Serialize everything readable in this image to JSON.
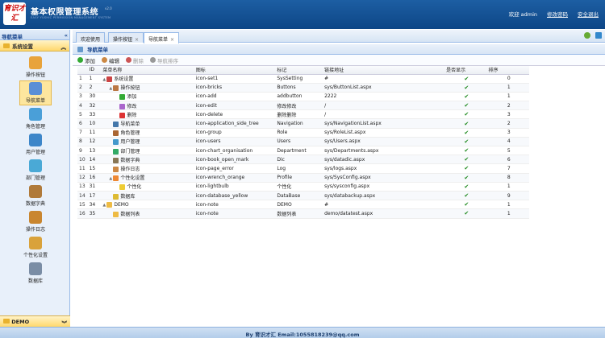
{
  "header": {
    "logo_text": "育识才汇",
    "title": "基本权限管理系统",
    "version": "v2.0",
    "subtitle": "EASY YUSHIC PERMISSION MANAGEMENT SYSTEM",
    "welcome": "欢迎 admin",
    "change_password": "修改密码",
    "logout": "安全退出"
  },
  "sidebar": {
    "head": "导航菜单",
    "group": "系统设置",
    "items": [
      {
        "label": "操作按钮",
        "icon": "buttons-icon"
      },
      {
        "label": "导航菜单",
        "icon": "navigation-icon"
      },
      {
        "label": "角色管理",
        "icon": "role-icon"
      },
      {
        "label": "用户管理",
        "icon": "users-icon"
      },
      {
        "label": "部门管理",
        "icon": "department-icon"
      },
      {
        "label": "数据字典",
        "icon": "dictionary-icon"
      },
      {
        "label": "操作日志",
        "icon": "log-icon"
      },
      {
        "label": "个性化设置",
        "icon": "profile-icon"
      },
      {
        "label": "数据库",
        "icon": "database-icon"
      }
    ],
    "bottom_group": "DEMO"
  },
  "tabs": [
    {
      "label": "欢迎使用",
      "close": ""
    },
    {
      "label": "操作按钮",
      "close": "×"
    },
    {
      "label": "导航菜单",
      "close": "×"
    }
  ],
  "panel_title": "导航菜单",
  "toolbar": {
    "add": "添加",
    "edit": "编辑",
    "delete": "删除",
    "order": "导航排序"
  },
  "columns": [
    "ID",
    "菜单名称",
    "图标",
    "标记",
    "链接地址",
    "是否显示",
    "排序"
  ],
  "rows": [
    {
      "n": "1",
      "id": "1",
      "name": "系统设置",
      "icon": "icon-set1",
      "tag": "SysSetting",
      "url": "#",
      "show": "✔",
      "sort": "0",
      "lvl": 0,
      "tw": "▲",
      "c": "#c44"
    },
    {
      "n": "2",
      "id": "2",
      "name": "操作按钮",
      "icon": "icon-bricks",
      "tag": "Buttons",
      "url": "sys/ButtonList.aspx",
      "show": "✔",
      "sort": "1",
      "lvl": 1,
      "tw": "▲",
      "c": "#b74"
    },
    {
      "n": "3",
      "id": "30",
      "name": "添加",
      "icon": "icon-add",
      "tag": "addbutton",
      "url": "2222",
      "show": "✔",
      "sort": "1",
      "lvl": 2,
      "tw": "",
      "c": "#3a3"
    },
    {
      "n": "4",
      "id": "32",
      "name": "修改",
      "icon": "icon-edit",
      "tag": "修改修改",
      "url": "/",
      "show": "✔",
      "sort": "2",
      "lvl": 2,
      "tw": "",
      "c": "#a6c"
    },
    {
      "n": "5",
      "id": "33",
      "name": "删除",
      "icon": "icon-delete",
      "tag": "删除删除",
      "url": "/",
      "show": "✔",
      "sort": "3",
      "lvl": 2,
      "tw": "",
      "c": "#d33"
    },
    {
      "n": "6",
      "id": "10",
      "name": "导航菜单",
      "icon": "icon-application_side_tree",
      "tag": "Navigation",
      "url": "sys/NavigationList.aspx",
      "show": "✔",
      "sort": "2",
      "lvl": 1,
      "tw": "",
      "c": "#47a"
    },
    {
      "n": "7",
      "id": "11",
      "name": "角色管理",
      "icon": "icon-group",
      "tag": "Role",
      "url": "sys/RoleList.aspx",
      "show": "✔",
      "sort": "3",
      "lvl": 1,
      "tw": "",
      "c": "#a63"
    },
    {
      "n": "8",
      "id": "12",
      "name": "用户管理",
      "icon": "icon-users",
      "tag": "Users",
      "url": "sys/Users.aspx",
      "show": "✔",
      "sort": "4",
      "lvl": 1,
      "tw": "",
      "c": "#49c"
    },
    {
      "n": "9",
      "id": "13",
      "name": "部门管理",
      "icon": "icon-chart_organisation",
      "tag": "Department",
      "url": "sys/Departments.aspx",
      "show": "✔",
      "sort": "5",
      "lvl": 1,
      "tw": "",
      "c": "#3a6"
    },
    {
      "n": "10",
      "id": "14",
      "name": "数据字典",
      "icon": "icon-book_open_mark",
      "tag": "Dic",
      "url": "sys/datadic.aspx",
      "show": "✔",
      "sort": "6",
      "lvl": 1,
      "tw": "",
      "c": "#875"
    },
    {
      "n": "11",
      "id": "15",
      "name": "操作日志",
      "icon": "icon-page_error",
      "tag": "Log",
      "url": "sys/logs.aspx",
      "show": "✔",
      "sort": "7",
      "lvl": 1,
      "tw": "",
      "c": "#c84"
    },
    {
      "n": "12",
      "id": "16",
      "name": "个性化设置",
      "icon": "icon-wrench_orange",
      "tag": "Profile",
      "url": "sys/SysConfig.aspx",
      "show": "✔",
      "sort": "8",
      "lvl": 1,
      "tw": "▲",
      "c": "#e83"
    },
    {
      "n": "13",
      "id": "31",
      "name": "个性化",
      "icon": "icon-lightbulb",
      "tag": "个性化",
      "url": "sys/sysconfig.aspx",
      "show": "✔",
      "sort": "1",
      "lvl": 2,
      "tw": "",
      "c": "#ec3"
    },
    {
      "n": "14",
      "id": "17",
      "name": "数据库",
      "icon": "icon-database_yellow",
      "tag": "DataBase",
      "url": "sys/databackup.aspx",
      "show": "✔",
      "sort": "9",
      "lvl": 1,
      "tw": "",
      "c": "#db3"
    },
    {
      "n": "15",
      "id": "34",
      "name": "DEMO",
      "icon": "icon-note",
      "tag": "DEMO",
      "url": "#",
      "show": "✔",
      "sort": "1",
      "lvl": 0,
      "tw": "▲",
      "c": "#eb4"
    },
    {
      "n": "16",
      "id": "35",
      "name": "数据列表",
      "icon": "icon-note",
      "tag": "数据列表",
      "url": "demo/datatest.aspx",
      "show": "✔",
      "sort": "1",
      "lvl": 1,
      "tw": "",
      "c": "#eb4"
    }
  ],
  "footer": "By 育识才汇 Email:1055818239@qq.com"
}
